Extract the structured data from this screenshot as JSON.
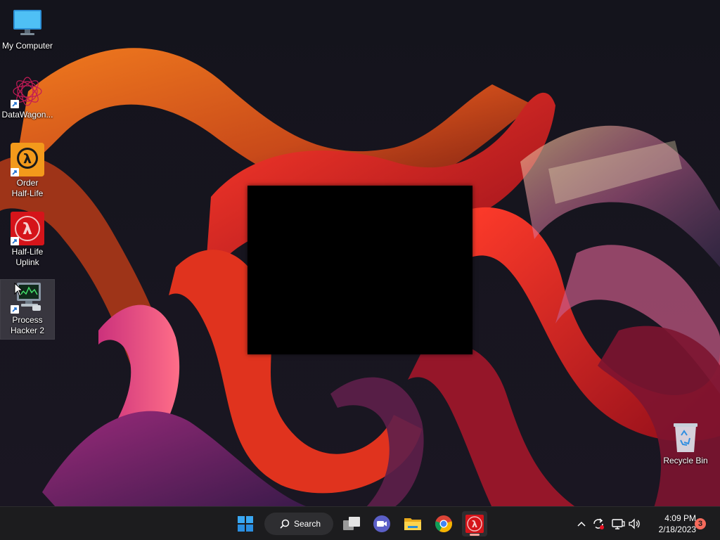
{
  "desktop": {
    "icons": [
      {
        "id": "my-computer",
        "label": "My Computer",
        "icon": "monitor-icon",
        "shortcut": false
      },
      {
        "id": "datawagon",
        "label": "DataWagon...",
        "icon": "spirograph-icon",
        "shortcut": true
      },
      {
        "id": "order-half-life",
        "label": "Order\nHalf-Life",
        "icon": "half-life-orange-icon",
        "shortcut": true
      },
      {
        "id": "half-life-uplink",
        "label": "Half-Life\nUplink",
        "icon": "half-life-red-icon",
        "shortcut": true
      },
      {
        "id": "process-hacker-2",
        "label": "Process\nHacker 2",
        "icon": "process-hacker-icon",
        "shortcut": true,
        "selected": true
      },
      {
        "id": "recycle-bin",
        "label": "Recycle Bin",
        "icon": "recycle-bin-icon",
        "shortcut": false
      }
    ]
  },
  "taskbar": {
    "search_label": "Search",
    "pinned": [
      {
        "id": "start",
        "icon": "windows-start-icon"
      },
      {
        "id": "task-view",
        "icon": "task-view-icon"
      },
      {
        "id": "teams-meet",
        "icon": "video-camera-icon"
      },
      {
        "id": "file-explorer",
        "icon": "folder-icon"
      },
      {
        "id": "chrome",
        "icon": "chrome-icon"
      },
      {
        "id": "half-life",
        "icon": "half-life-icon",
        "active": true
      }
    ],
    "tray": {
      "icons": [
        "chevron-up-icon",
        "sync-icon",
        "network-icon",
        "speaker-icon"
      ],
      "time": "4:09 PM",
      "date": "2/18/2023",
      "notification_count": "3"
    }
  },
  "colors": {
    "taskbar_bg": "#1c1c1e",
    "accent": "#ffa39a",
    "badge": "#f56b5c"
  }
}
